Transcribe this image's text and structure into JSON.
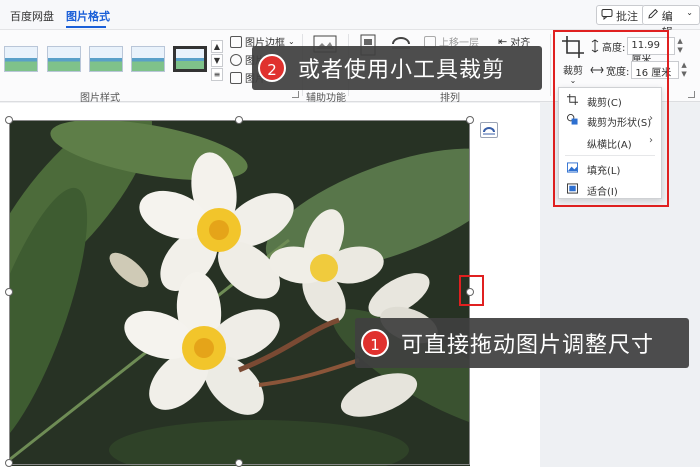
{
  "tabs": [
    {
      "label": "百度网盘",
      "active": false
    },
    {
      "label": "图片格式",
      "active": true
    }
  ],
  "top_actions": {
    "comment_label": "批注",
    "edit_label": "编辑"
  },
  "ribbon": {
    "picture_styles_label": "图片样式",
    "picture_border_label": "图片边框",
    "picture_effects_label": "图片",
    "picture_layout_label": "图片",
    "assist_label": "辅助功能",
    "arrange_label": "排列",
    "bring_forward_label": "上移一层",
    "align_label": "对齐",
    "crop_label": "裁剪",
    "height_label": "高度:",
    "height_value": "11.99 厘米",
    "width_label": "宽度:",
    "width_value": "16 厘米"
  },
  "crop_menu": {
    "items": [
      {
        "label": "裁剪(C)",
        "icon": "crop-icon",
        "has_submenu": false
      },
      {
        "label": "裁剪为形状(S)",
        "icon": "shape-crop-icon",
        "has_submenu": true
      },
      {
        "label": "纵横比(A)",
        "icon": "",
        "has_submenu": true
      },
      {
        "label": "填充(L)",
        "icon": "fill-icon",
        "has_submenu": false
      },
      {
        "label": "适合(I)",
        "icon": "fit-icon",
        "has_submenu": false
      }
    ]
  },
  "callouts": [
    {
      "number": "2",
      "text": "或者使用小工具裁剪"
    },
    {
      "number": "1",
      "text": "可直接拖动图片调整尺寸"
    }
  ],
  "colors": {
    "accent": "#1a5fd8",
    "highlight_red": "#e02020",
    "callout_bg": "#404040"
  }
}
